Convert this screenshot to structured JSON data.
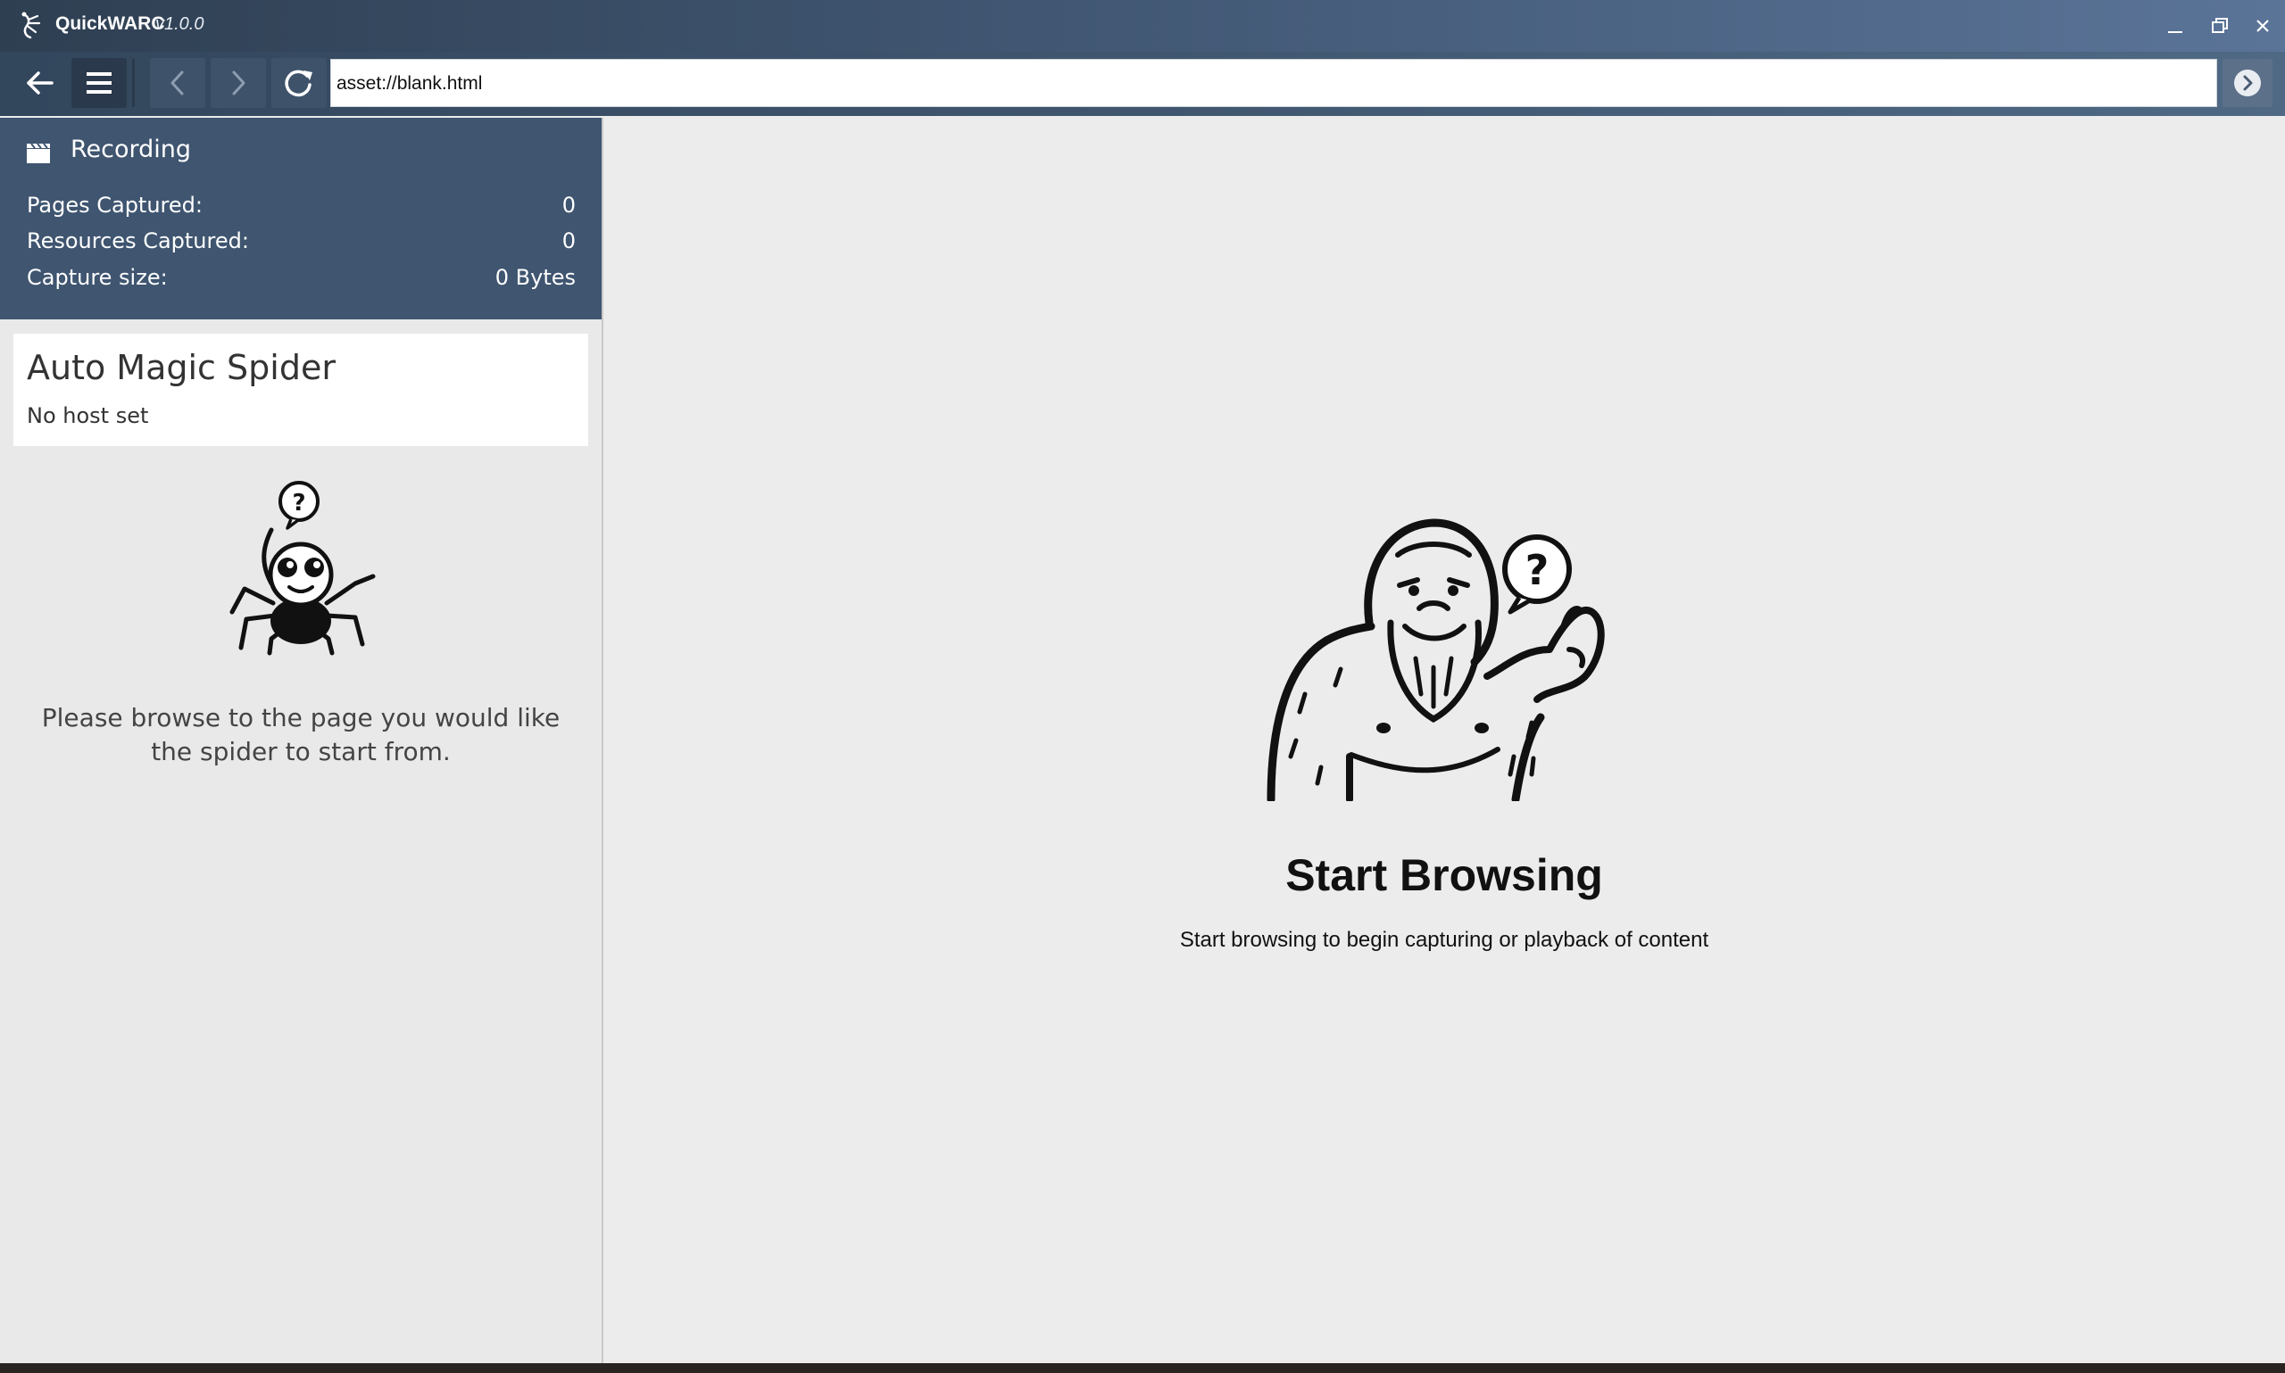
{
  "window": {
    "app_name": "QuickWARC",
    "version": "v1.0.0"
  },
  "toolbar": {
    "url_value": "asset://blank.html"
  },
  "recording": {
    "title": "Recording",
    "stats": [
      {
        "label": "Pages Captured:",
        "value": "0"
      },
      {
        "label": "Resources Captured:",
        "value": "0"
      },
      {
        "label": "Capture size:",
        "value": "0 Bytes"
      }
    ]
  },
  "spider": {
    "title": "Auto Magic Spider",
    "host": "No host set",
    "message": "Please browse to the page you would like the spider to start from."
  },
  "main": {
    "title": "Start Browsing",
    "subtitle": "Start browsing to begin capturing or playback of content"
  },
  "icons": {
    "app": "app-logo-icon",
    "minimize": "minimize-icon",
    "maximize": "restore-icon",
    "close": "close-icon",
    "back": "arrow-left-icon",
    "menu": "hamburger-icon",
    "prev": "chevron-left-icon",
    "next": "chevron-right-icon",
    "reload": "reload-icon",
    "go": "go-arrow-icon",
    "recording": "clapperboard-icon"
  },
  "colors": {
    "titlebar": "#405672",
    "recording_panel": "#3f5570",
    "background": "#ececec"
  }
}
